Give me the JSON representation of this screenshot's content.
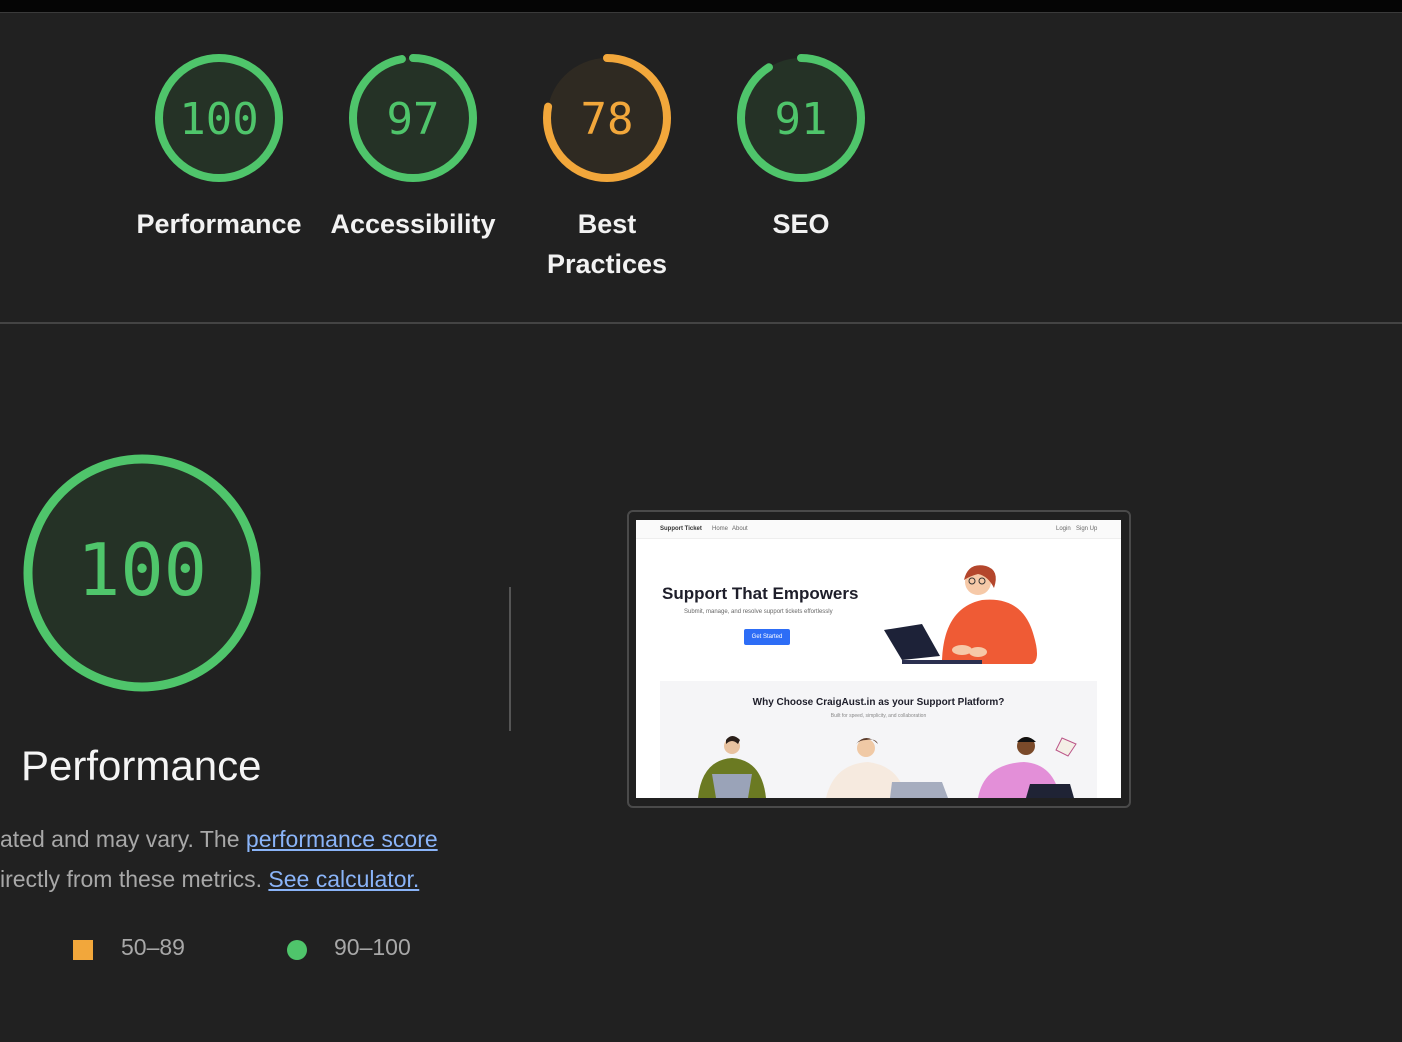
{
  "colors": {
    "pass": "#4fc56b",
    "pass_bg": "#253226",
    "average": "#f2a73b",
    "average_bg": "#2f2a22"
  },
  "categories": [
    {
      "id": "performance",
      "score": 100,
      "label": "Performance",
      "rating": "pass"
    },
    {
      "id": "accessibility",
      "score": 97,
      "label": "Accessibility",
      "rating": "pass"
    },
    {
      "id": "best-practices",
      "score": 78,
      "label": "Best Practices",
      "rating": "average"
    },
    {
      "id": "seo",
      "score": 91,
      "label": "SEO",
      "rating": "pass"
    }
  ],
  "performance_detail": {
    "score": 100,
    "title": "Performance",
    "desc_line1_prefix": "ated and may vary. The ",
    "desc_line1_link": "performance score",
    "desc_line2_prefix": "irectly from these metrics. ",
    "desc_line2_link": "See calculator."
  },
  "legend": {
    "average_range": "50–89",
    "pass_range": "90–100"
  },
  "screenshot": {
    "brand": "Support Ticket",
    "nav_home": "Home",
    "nav_about": "About",
    "nav_login": "Login",
    "nav_signup": "Sign Up",
    "hero_title": "Support That Empowers",
    "hero_subtitle": "Submit, manage, and resolve support tickets effortlessly",
    "hero_button": "Get Started",
    "section_title": "Why Choose CraigAust.in as your Support Platform?",
    "section_subtitle": "Built for speed, simplicity, and collaboration"
  }
}
